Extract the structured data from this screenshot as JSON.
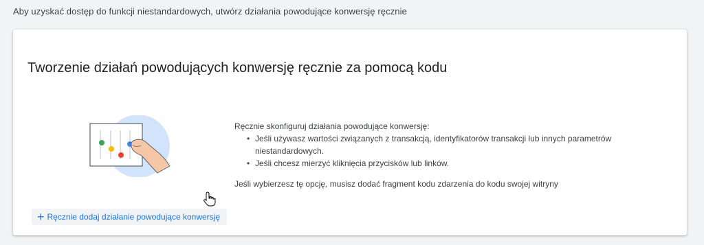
{
  "top_note": "Aby uzyskać dostęp do funkcji niestandardowych, utwórz działania powodujące konwersję ręcznie",
  "card": {
    "title": "Tworzenie działań powodujących konwersję ręcznie za pomocą kodu",
    "intro": "Ręcznie skonfiguruj działania powodujące konwersję:",
    "bullets": [
      "Jeśli używasz wartości związanych z transakcją, identyfikatorów transakcji lub innych parametrów niestandardowych.",
      "Jeśli chcesz mierzyć kliknięcia przycisków lub linków."
    ],
    "note": "Jeśli wybierzesz tę opcję, musisz dodać fragment kodu zdarzenia do kodu swojej witryny",
    "add_button_label": "Ręcznie dodaj działanie powodujące konwersję"
  },
  "icons": {
    "add": "plus-icon",
    "illustration": "hand-adjusting-sliders-illustration",
    "cursor": "hand-pointer-cursor-icon"
  },
  "colors": {
    "accent": "#1a73e8",
    "illustration_circle": "#d2e3fc",
    "dot_green": "#34a853",
    "dot_yellow": "#fbbc04",
    "dot_red": "#ea4335",
    "dot_blue": "#4285f4",
    "hand": "#f6c7a6"
  }
}
